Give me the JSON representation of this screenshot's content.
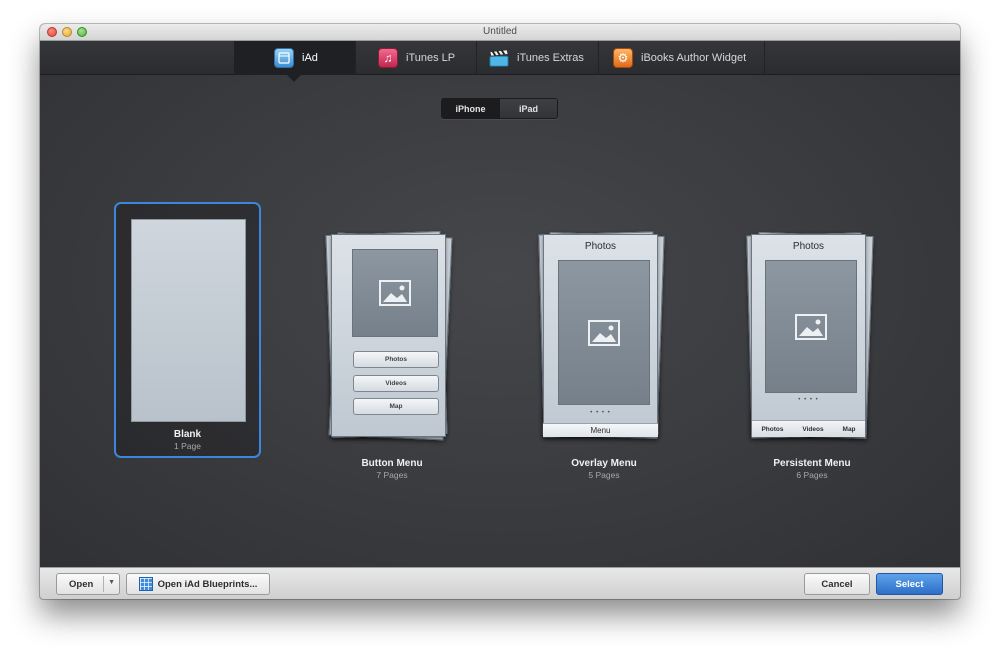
{
  "window": {
    "title": "Untitled"
  },
  "tabs": [
    {
      "label": "iAd",
      "icon": "iad-icon",
      "active": true
    },
    {
      "label": "iTunes LP",
      "icon": "music-note-icon",
      "active": false
    },
    {
      "label": "iTunes Extras",
      "icon": "clapperboard-icon",
      "active": false
    },
    {
      "label": "iBooks Author Widget",
      "icon": "gear-widget-icon",
      "active": false
    }
  ],
  "device_selector": {
    "options": [
      "iPhone",
      "iPad"
    ],
    "selected": "iPhone"
  },
  "templates": [
    {
      "name": "Blank",
      "pages": "1 Page",
      "selected": true
    },
    {
      "name": "Button Menu",
      "pages": "7 Pages",
      "buttons": [
        "Photos",
        "Videos",
        "Map"
      ]
    },
    {
      "name": "Overlay Menu",
      "pages": "5 Pages",
      "heading": "Photos",
      "menu_label": "Menu",
      "dots": "• • • •"
    },
    {
      "name": "Persistent Menu",
      "pages": "6 Pages",
      "heading": "Photos",
      "tabs": [
        "Photos",
        "Videos",
        "Map"
      ],
      "dots": "• • • •"
    }
  ],
  "footer": {
    "open_label": "Open",
    "blueprints_label": "Open iAd Blueprints...",
    "cancel_label": "Cancel",
    "select_label": "Select"
  },
  "colors": {
    "selection": "#3c86dd",
    "primary_button": "#2d6fc8"
  }
}
